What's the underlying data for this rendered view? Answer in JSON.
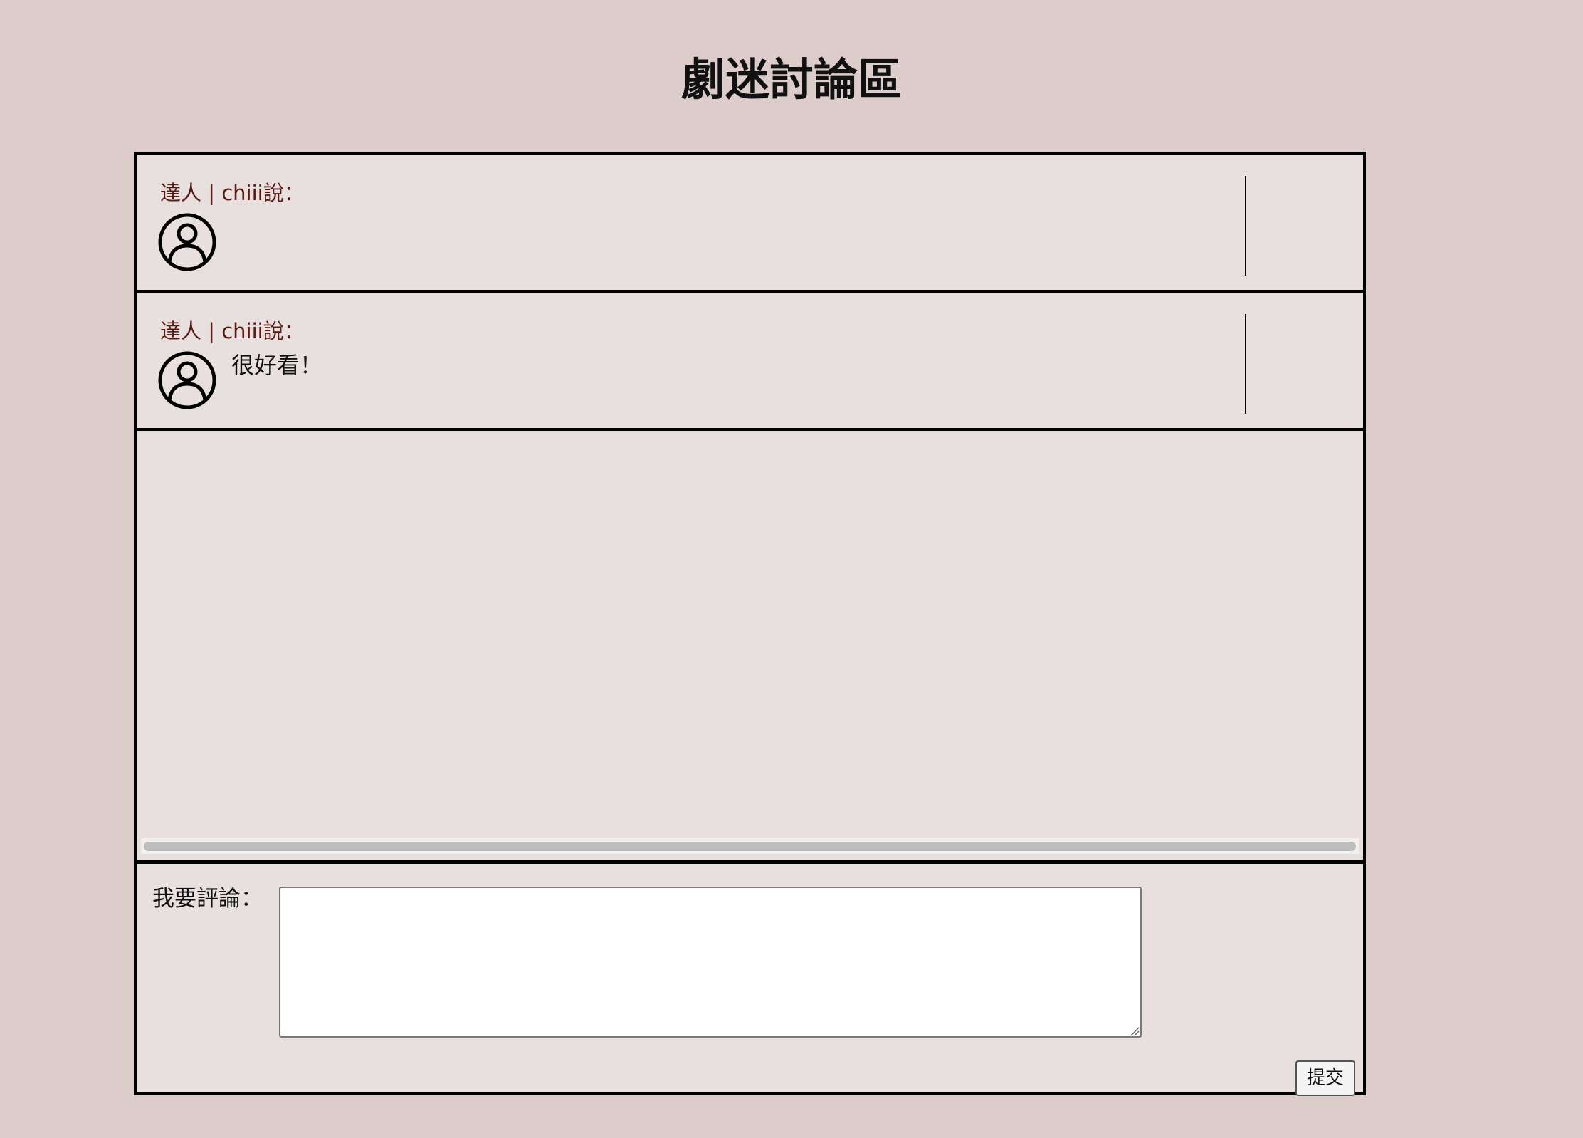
{
  "header": {
    "title": "劇迷討論區"
  },
  "comments": [
    {
      "author": "達人 | chiii說：",
      "body": "",
      "avatar_icon": "user-circle-icon"
    },
    {
      "author": "達人 | chiii說：",
      "body": "很好看！",
      "avatar_icon": "user-circle-icon"
    }
  ],
  "compose": {
    "label": "我要評論：",
    "value": "",
    "submit_label": "提交"
  },
  "colors": {
    "page_background": "#dccdcb",
    "panel_background": "#e8e0de",
    "author_text": "#5a1a14"
  }
}
